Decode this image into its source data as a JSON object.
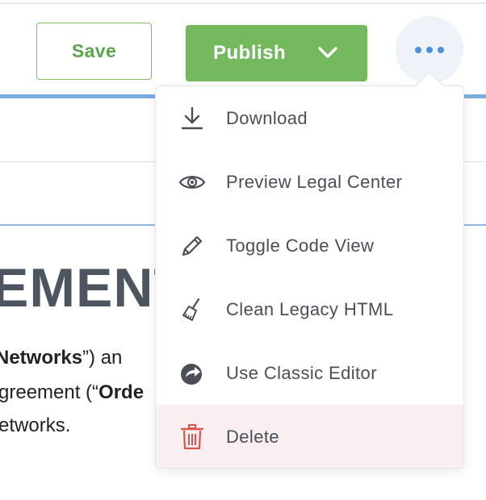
{
  "toolbar": {
    "save_label": "Save",
    "publish_label": "Publish",
    "more_icon": "more-horizontal-icon"
  },
  "document": {
    "heading": "EMENT",
    "line1_bold_name": "Networks",
    "line1_tail": "”) an",
    "line2_prefix": "greement (“",
    "line2_bold": "Orde",
    "line3": "etworks."
  },
  "menu": {
    "items": [
      {
        "label": "Download",
        "icon": "download-icon"
      },
      {
        "label": "Preview Legal Center",
        "icon": "eye-icon"
      },
      {
        "label": "Toggle Code View",
        "icon": "pencil-icon"
      },
      {
        "label": "Clean Legacy HTML",
        "icon": "broom-icon"
      },
      {
        "label": "Use Classic Editor",
        "icon": "share-icon"
      },
      {
        "label": "Delete",
        "icon": "trash-icon"
      }
    ]
  },
  "colors": {
    "publish": "#75b95e",
    "save_border": "#7fbd6b",
    "accent_blue": "#4f8fd6",
    "delete_red": "#d9534f",
    "delete_bg": "#f9eff1"
  }
}
